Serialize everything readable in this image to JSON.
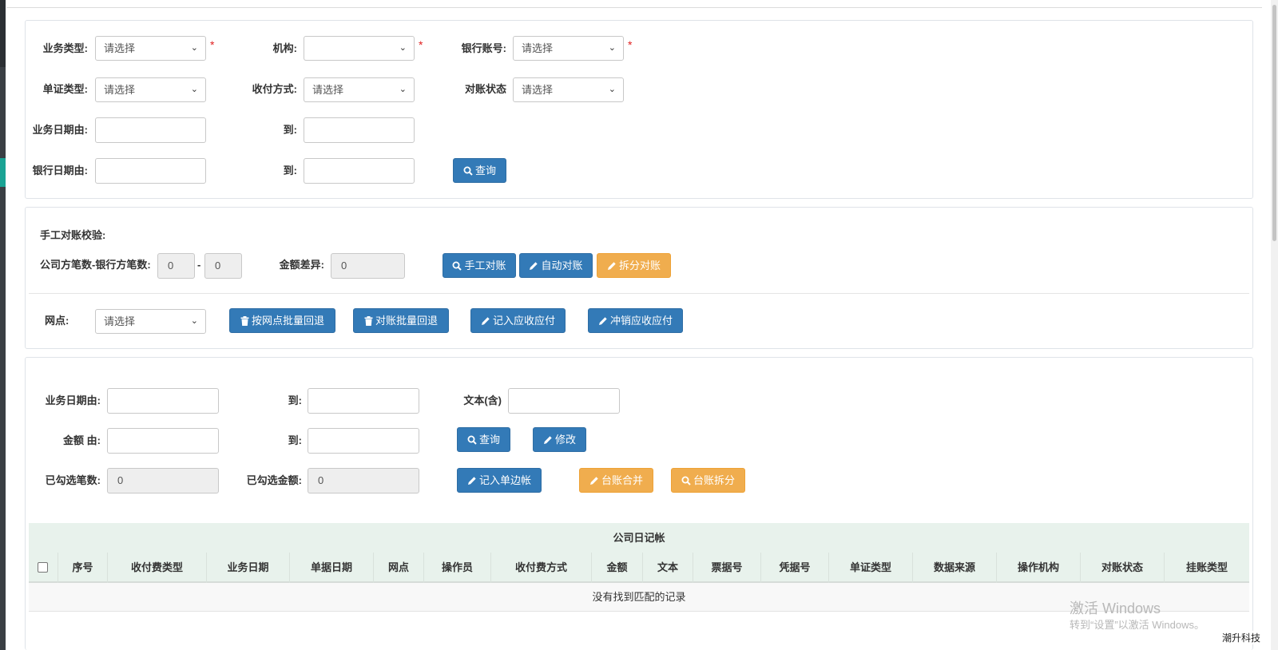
{
  "filters": {
    "biz_type": {
      "label": "业务类型:",
      "value": "请选择",
      "required": "*"
    },
    "org": {
      "label": "机构:",
      "value": "",
      "required": "*"
    },
    "bank_account": {
      "label": "银行账号:",
      "value": "请选择",
      "required": "*"
    },
    "voucher_type": {
      "label": "单证类型:",
      "value": "请选择"
    },
    "pay_method": {
      "label": "收付方式:",
      "value": "请选择"
    },
    "recon_status": {
      "label": "对账状态",
      "value": "请选择"
    },
    "biz_date_from": {
      "label": "业务日期由:",
      "value": ""
    },
    "biz_date_to": {
      "label": "到:",
      "value": ""
    },
    "bank_date_from": {
      "label": "银行日期由:",
      "value": ""
    },
    "bank_date_to": {
      "label": "到:",
      "value": ""
    },
    "query_button": "查询"
  },
  "manual": {
    "title": "手工对账校验:",
    "count_label": "公司方笔数-银行方笔数:",
    "company_count": "0",
    "dash": "-",
    "bank_count": "0",
    "diff_label": "金额差异:",
    "diff_value": "0",
    "btn_manual": "手工对账",
    "btn_auto": "自动对账",
    "btn_split": "拆分对账",
    "branch_label": "网点:",
    "branch_value": "请选择",
    "btn_batch_branch": "按网点批量回退",
    "btn_batch_recon": "对账批量回退",
    "btn_record": "记入应收应付",
    "btn_reverse": "冲销应收应付"
  },
  "ledger": {
    "biz_date_from": {
      "label": "业务日期由:",
      "value": ""
    },
    "biz_date_to": {
      "label": "到:",
      "value": ""
    },
    "text_contains": {
      "label": "文本(含)",
      "value": ""
    },
    "amount_from": {
      "label": "金额 由:",
      "value": ""
    },
    "amount_to": {
      "label": "到:",
      "value": ""
    },
    "btn_query": "查询",
    "btn_edit": "修改",
    "selected_count": {
      "label": "已勾选笔数:",
      "value": "0"
    },
    "selected_amount": {
      "label": "已勾选金额:",
      "value": "0"
    },
    "btn_single": "记入单边帐",
    "btn_merge": "台账合并",
    "btn_split": "台账拆分"
  },
  "table": {
    "title": "公司日记帐",
    "columns": [
      "序号",
      "收付费类型",
      "业务日期",
      "单据日期",
      "网点",
      "操作员",
      "收付费方式",
      "金额",
      "文本",
      "票据号",
      "凭据号",
      "单证类型",
      "数据来源",
      "操作机构",
      "对账状态",
      "挂账类型"
    ],
    "empty_text": "没有找到匹配的记录"
  },
  "watermark": {
    "line1": "激活 Windows",
    "line2": "转到“设置”以激活 Windows。"
  },
  "brand": "潮升科技"
}
